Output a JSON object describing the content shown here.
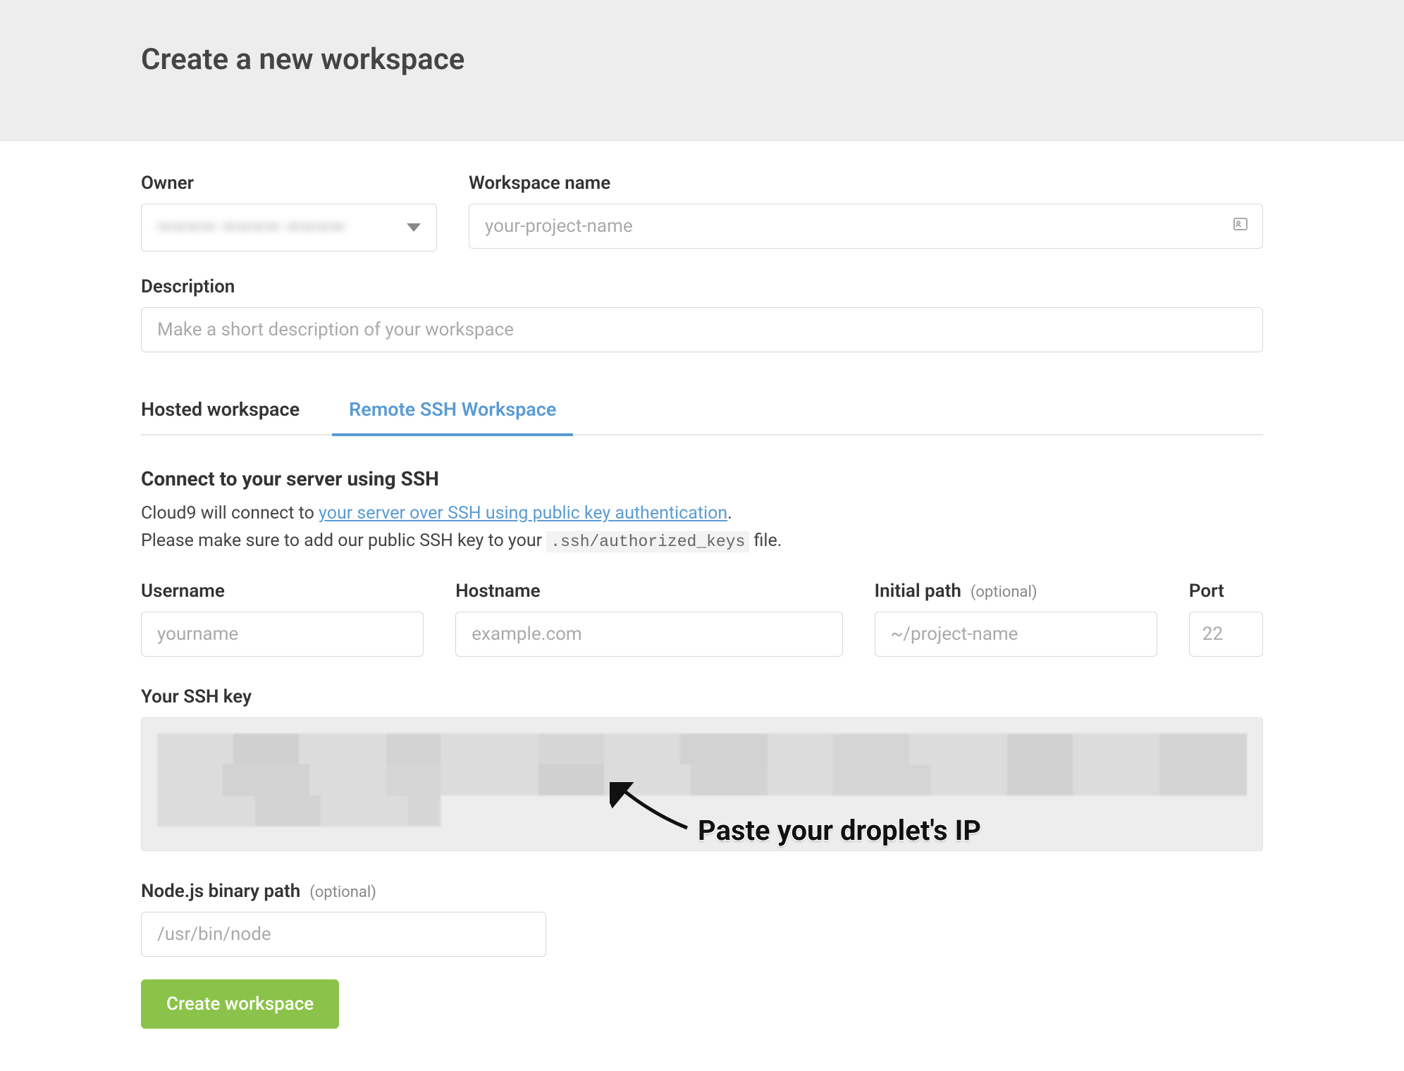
{
  "header": {
    "title": "Create a new workspace"
  },
  "form": {
    "owner_label": "Owner",
    "owner_value": "———— ———— ————",
    "wname_label": "Workspace name",
    "wname_placeholder": "your-project-name",
    "desc_label": "Description",
    "desc_placeholder": "Make a short description of your workspace"
  },
  "tabs": {
    "hosted": "Hosted workspace",
    "remote": "Remote SSH Workspace"
  },
  "ssh": {
    "heading": "Connect to your server using SSH",
    "text_pre": "Cloud9 will connect to ",
    "link_your_server": "your server",
    "link_rest": " over SSH using public key authentication",
    "text_post": ".",
    "text_line2_pre": "Please make sure to add our public SSH key to your ",
    "text_code": ".ssh/authorized_keys",
    "text_line2_post": " file.",
    "username_label": "Username",
    "username_placeholder": "yourname",
    "hostname_label": "Hostname",
    "hostname_placeholder": "example.com",
    "initial_path_label": "Initial path",
    "initial_path_placeholder": "~/project-name",
    "port_label": "Port",
    "port_placeholder": "22",
    "optional_text": "(optional)",
    "ssh_key_label": "Your SSH key",
    "node_label": "Node.js binary path",
    "node_placeholder": "/usr/bin/node"
  },
  "button": {
    "create": "Create workspace"
  },
  "annotation": {
    "text": "Paste your droplet's IP"
  }
}
